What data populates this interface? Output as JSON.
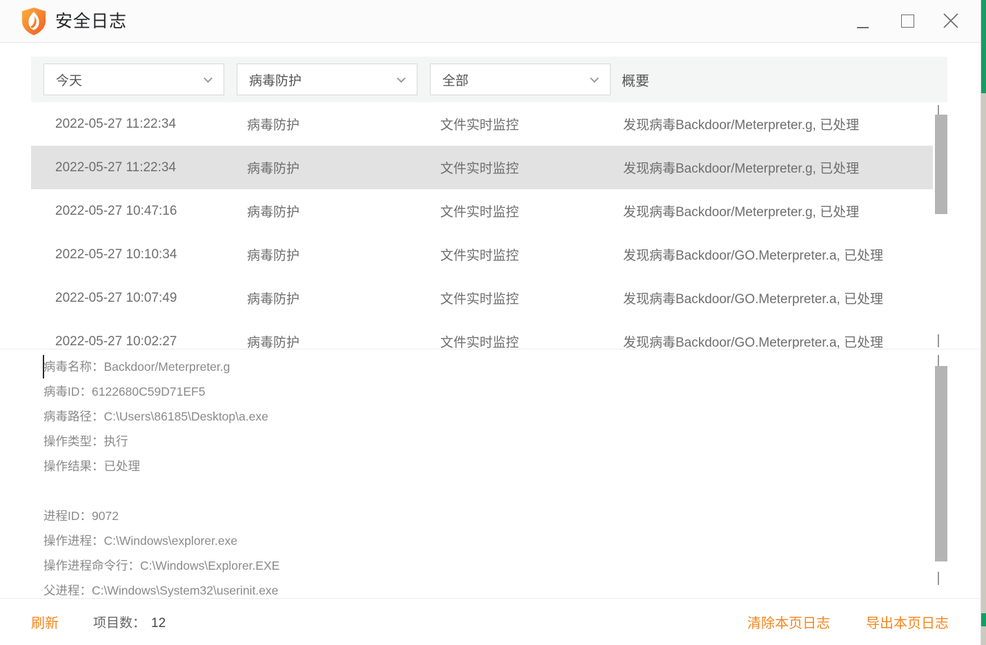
{
  "window": {
    "title": "安全日志"
  },
  "filters": [
    {
      "value": "今天"
    },
    {
      "value": "病毒防护"
    },
    {
      "value": "全部"
    }
  ],
  "table": {
    "summary_header": "概要",
    "rows": [
      {
        "time": "2022-05-27 11:22:34",
        "category": "病毒防护",
        "monitor": "文件实时监控",
        "summary": "发现病毒Backdoor/Meterpreter.g, 已处理",
        "selected": false
      },
      {
        "time": "2022-05-27 11:22:34",
        "category": "病毒防护",
        "monitor": "文件实时监控",
        "summary": "发现病毒Backdoor/Meterpreter.g, 已处理",
        "selected": true
      },
      {
        "time": "2022-05-27 10:47:16",
        "category": "病毒防护",
        "monitor": "文件实时监控",
        "summary": "发现病毒Backdoor/Meterpreter.g, 已处理",
        "selected": false
      },
      {
        "time": "2022-05-27 10:10:34",
        "category": "病毒防护",
        "monitor": "文件实时监控",
        "summary": "发现病毒Backdoor/GO.Meterpreter.a, 已处理",
        "selected": false
      },
      {
        "time": "2022-05-27 10:07:49",
        "category": "病毒防护",
        "monitor": "文件实时监控",
        "summary": "发现病毒Backdoor/GO.Meterpreter.a, 已处理",
        "selected": false
      },
      {
        "time": "2022-05-27 10:02:27",
        "category": "病毒防护",
        "monitor": "文件实时监控",
        "summary": "发现病毒Backdoor/GO.Meterpreter.a, 已处理",
        "selected": false
      }
    ]
  },
  "details": {
    "lines": [
      "病毒名称：Backdoor/Meterpreter.g",
      "病毒ID：6122680C59D71EF5",
      "病毒路径：C:\\Users\\86185\\Desktop\\a.exe",
      "操作类型：执行",
      "操作结果：已处理",
      "",
      "进程ID：9072",
      "操作进程：C:\\Windows\\explorer.exe",
      "操作进程命令行：C:\\Windows\\Explorer.EXE",
      "父进程：C:\\Windows\\System32\\userinit.exe"
    ]
  },
  "footer": {
    "refresh_label": "刷新",
    "count_label": "项目数：",
    "count_value": "12",
    "clear_label": "清除本页日志",
    "export_label": "导出本页日志"
  },
  "colors": {
    "accent_orange": "#f5861d",
    "selected_row": "#e2e2e2",
    "logo_gradient_start": "#fbb03b",
    "logo_gradient_end": "#f15a24",
    "edge_green": "#149e63"
  }
}
